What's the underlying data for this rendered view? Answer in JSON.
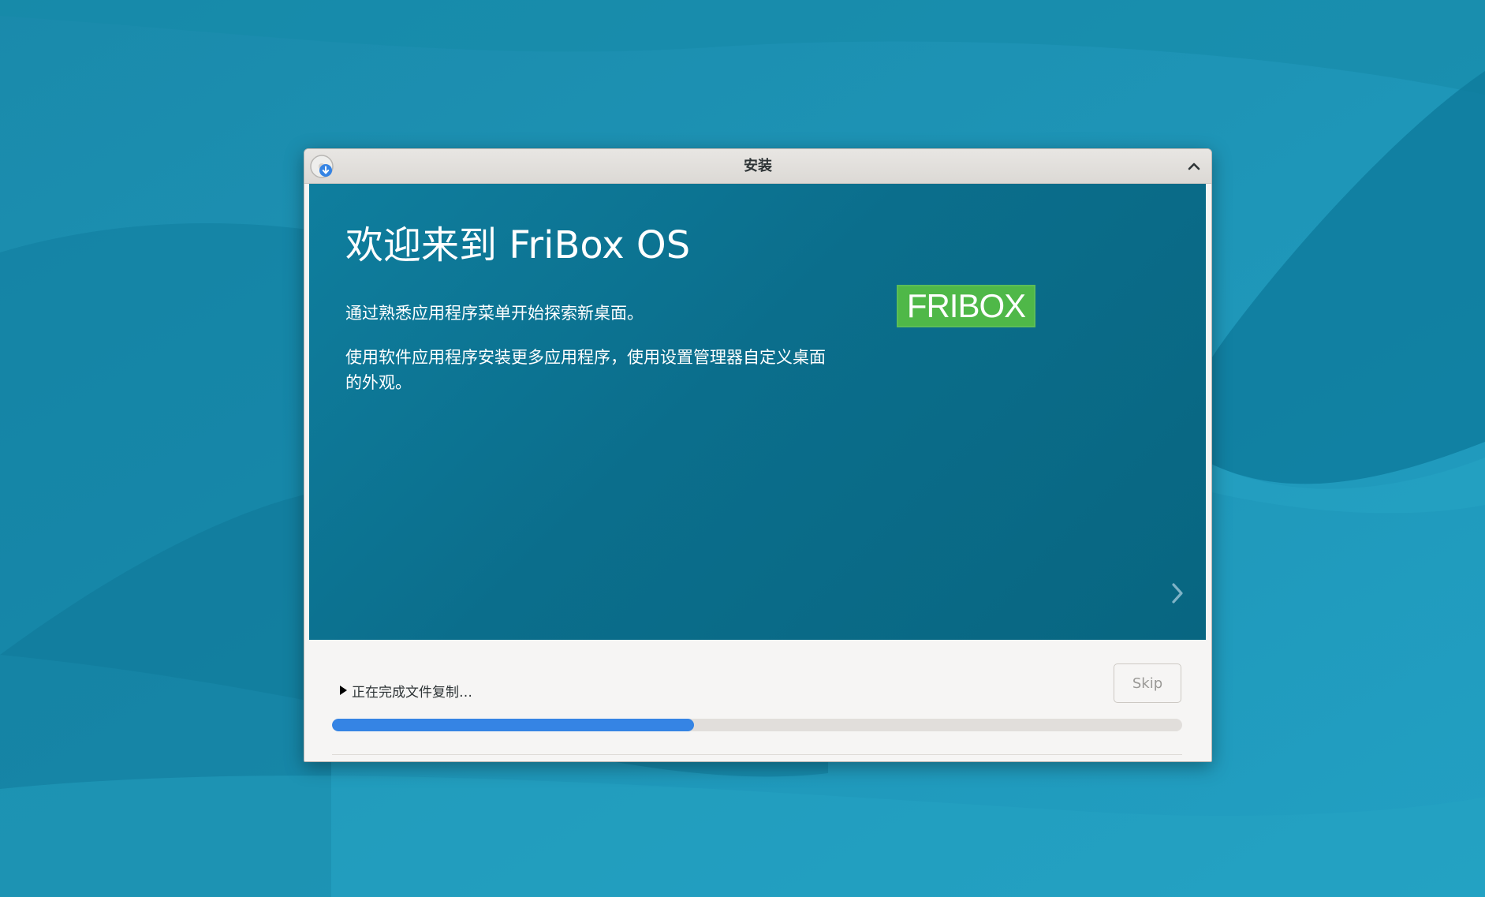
{
  "window": {
    "title": "安装"
  },
  "slide": {
    "title": "欢迎来到 FriBox OS",
    "paragraph1": "通过熟悉应用程序菜单开始探索新桌面。",
    "paragraph2": "使用软件应用程序安装更多应用程序，使用设置管理器自定义桌面的外观。",
    "logo_text": "FRIBOX",
    "next_icon": "chevron-right-icon"
  },
  "status": {
    "text": "正在完成文件复制…",
    "expander_icon": "triangle-right-icon"
  },
  "skip_button": {
    "label": "Skip"
  },
  "progress": {
    "fraction": 0.426
  },
  "colors": {
    "accent": "#3584e4",
    "slide_bg": "#0b6e8c",
    "logo_green": "#4fb848"
  }
}
